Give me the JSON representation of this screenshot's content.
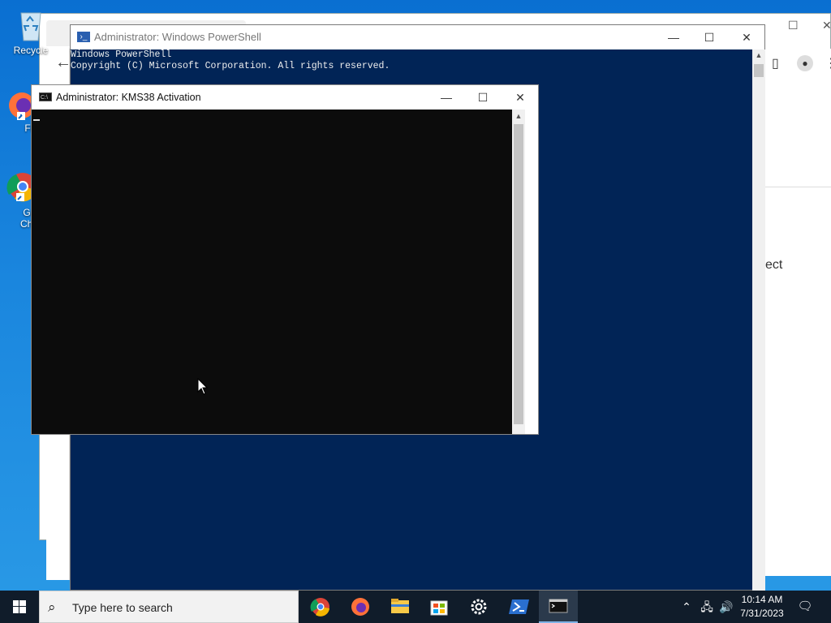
{
  "desktop": {
    "icons": [
      {
        "label": "Recycle",
        "icon": "recycle-bin-icon"
      },
      {
        "label": "Fire",
        "icon": "firefox-icon"
      },
      {
        "label": "Goo\nChro",
        "icon": "chrome-icon"
      }
    ]
  },
  "background_window": {
    "right_fragment": "ect"
  },
  "powershell": {
    "title": "Administrator: Windows PowerShell",
    "lines": [
      "Windows PowerShell",
      "Copyright (C) Microsoft Corporation. All rights reserved."
    ],
    "background": "#012456"
  },
  "cmd": {
    "title": "Administrator:  KMS38 Activation",
    "background": "#0c0c0c"
  },
  "taskbar": {
    "search_placeholder": "Type here to search",
    "apps": [
      "chrome-icon",
      "firefox-icon",
      "file-explorer-icon",
      "store-icon",
      "settings-icon",
      "powershell-icon",
      "cmd-icon"
    ],
    "time": "10:14 AM",
    "date": "7/31/2023"
  }
}
